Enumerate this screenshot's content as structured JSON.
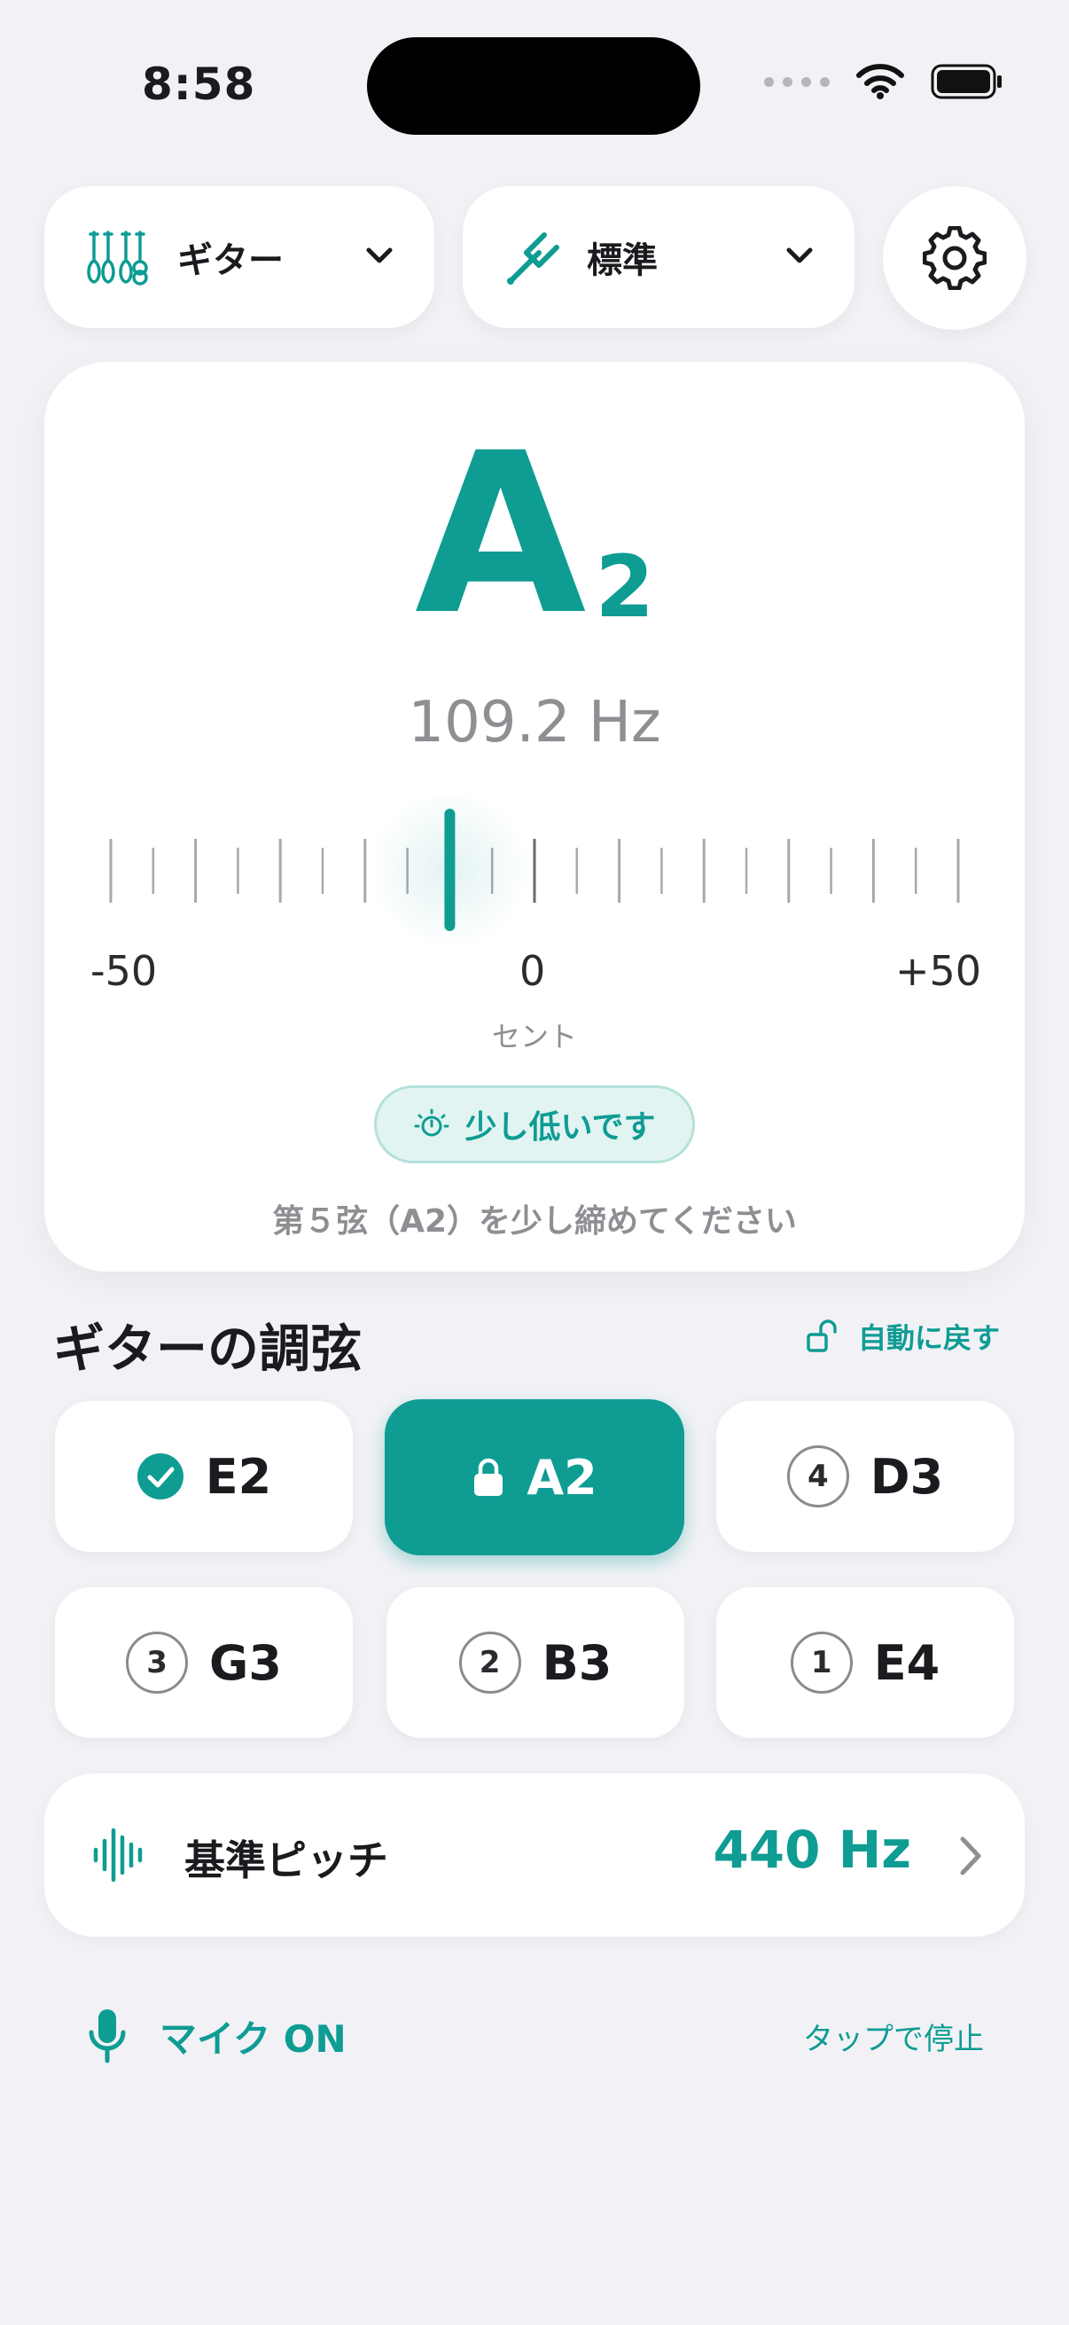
{
  "status_bar": {
    "time": "8:58"
  },
  "top_controls": {
    "instrument_label": "ギター",
    "tuning_label": "標準"
  },
  "tuner": {
    "note_letter": "A",
    "note_octave": "2",
    "frequency": "109.2 Hz",
    "cents_value": -10,
    "scale_min": "-50",
    "scale_mid": "0",
    "scale_max": "+50",
    "unit": "セント",
    "status_badge": "少し低いです",
    "hint": "第５弦（A2）を少し締めてください"
  },
  "strings_section": {
    "title": "ギターの調弦",
    "auto_return": "自動に戻す",
    "strings": [
      {
        "label": "E2",
        "marker": "check"
      },
      {
        "label": "A2",
        "marker": "lock"
      },
      {
        "label": "D3",
        "marker": "4"
      },
      {
        "label": "G3",
        "marker": "3"
      },
      {
        "label": "B3",
        "marker": "2"
      },
      {
        "label": "E4",
        "marker": "1"
      }
    ]
  },
  "reference_pitch": {
    "label": "基準ピッチ",
    "value": "440 Hz"
  },
  "mic": {
    "label": "マイク ON",
    "action": "タップで停止"
  },
  "colors": {
    "accent": "#0E9C93",
    "background": "#F2F2F6",
    "card": "#FFFFFF",
    "muted_text": "#8E8E93"
  }
}
